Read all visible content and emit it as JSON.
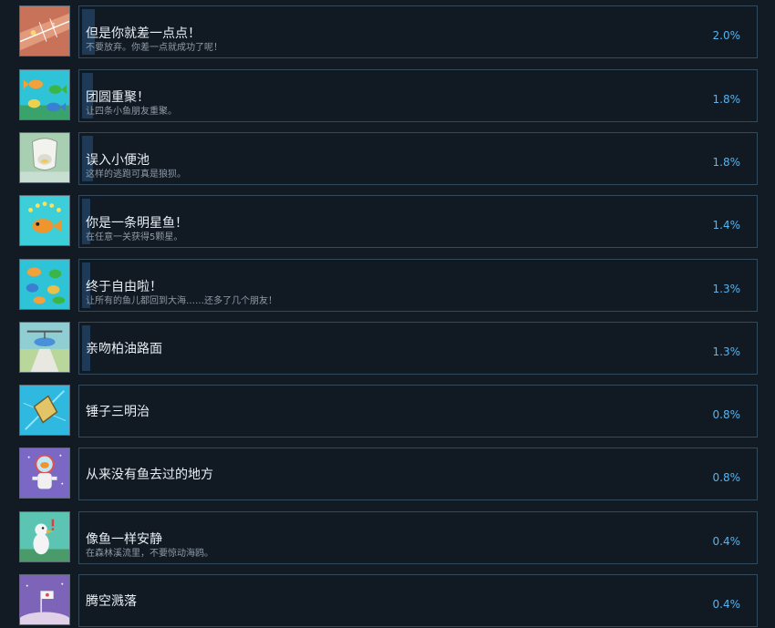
{
  "achievements": [
    {
      "title": "但是你就差一点点！",
      "desc": "不要放弃。你差一点就成功了呢！",
      "percent": "2.0%",
      "rate": 2.0,
      "icon": "shuffleboard-icon",
      "icon_bg": "#c8725a"
    },
    {
      "title": "团圆重聚！",
      "desc": "让四条小鱼朋友重聚。",
      "percent": "1.8%",
      "rate": 1.8,
      "icon": "fish-friends-icon",
      "icon_bg": "#2fc3d8"
    },
    {
      "title": "误入小便池",
      "desc": "这样的逃跑可真是狼狈。",
      "percent": "1.8%",
      "rate": 1.8,
      "icon": "urinal-icon",
      "icon_bg": "#a9cfb3"
    },
    {
      "title": "你是一条明星鱼！",
      "desc": "在任意一关获得5颗星。",
      "percent": "1.4%",
      "rate": 1.4,
      "icon": "star-fish-icon",
      "icon_bg": "#3ccfd9"
    },
    {
      "title": "终于自由啦！",
      "desc": "让所有的鱼儿都回到大海……还多了几个朋友！",
      "percent": "1.3%",
      "rate": 1.3,
      "icon": "free-fish-icon",
      "icon_bg": "#2fc3d8"
    },
    {
      "title": "亲吻柏油路面",
      "desc": "",
      "percent": "1.3%",
      "rate": 1.3,
      "icon": "road-kiss-icon",
      "icon_bg": "#8fcfd4"
    },
    {
      "title": "锤子三明治",
      "desc": "",
      "percent": "0.8%",
      "rate": 0.8,
      "icon": "sandwich-icon",
      "icon_bg": "#2fb9e0"
    },
    {
      "title": "从来没有鱼去过的地方",
      "desc": "",
      "percent": "0.8%",
      "rate": 0.8,
      "icon": "astronaut-fish-icon",
      "icon_bg": "#7a68c4"
    },
    {
      "title": "像鱼一样安静",
      "desc": "在森林溪流里，不要惊动海鸥。",
      "percent": "0.4%",
      "rate": 0.4,
      "icon": "seagull-icon",
      "icon_bg": "#5cc4b3"
    },
    {
      "title": "腾空溅落",
      "desc": "",
      "percent": "0.4%",
      "rate": 0.4,
      "icon": "planet-fish-icon",
      "icon_bg": "#7d64b9"
    }
  ]
}
